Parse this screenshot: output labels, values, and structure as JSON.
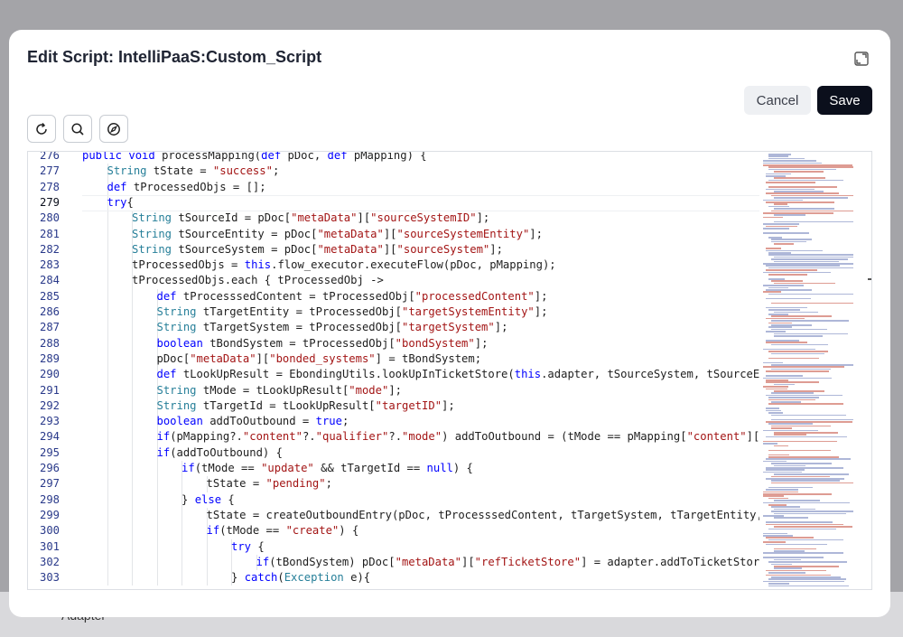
{
  "dialog": {
    "title": "Edit Script: IntelliPaaS:Custom_Script",
    "cancel_label": "Cancel",
    "save_label": "Save"
  },
  "toolbar": {
    "icons": [
      "refresh-icon",
      "search-icon",
      "compass-icon"
    ]
  },
  "background": {
    "row_label": "Adapter"
  },
  "editor": {
    "current_line": 279,
    "first_visible_line": 276,
    "lines": [
      {
        "n": 276,
        "indent": 1,
        "tokens": [
          [
            "kw",
            "public"
          ],
          [
            "t",
            " "
          ],
          [
            "kw",
            "void"
          ],
          [
            "t",
            " processMapping("
          ],
          [
            "kw",
            "def"
          ],
          [
            "t",
            " pDoc, "
          ],
          [
            "kw",
            "def"
          ],
          [
            "t",
            " pMapping) {"
          ]
        ]
      },
      {
        "n": 277,
        "indent": 2,
        "tokens": [
          [
            "ty",
            "String"
          ],
          [
            "t",
            " tState = "
          ],
          [
            "st",
            "\"success\""
          ],
          [
            "t",
            ";"
          ]
        ]
      },
      {
        "n": 278,
        "indent": 2,
        "tokens": [
          [
            "kw",
            "def"
          ],
          [
            "t",
            " tProcessedObjs = [];"
          ]
        ]
      },
      {
        "n": 279,
        "indent": 2,
        "tokens": [
          [
            "kw",
            "try"
          ],
          [
            "t",
            "{"
          ]
        ]
      },
      {
        "n": 280,
        "indent": 3,
        "tokens": [
          [
            "ty",
            "String"
          ],
          [
            "t",
            " tSourceId = pDoc["
          ],
          [
            "st",
            "\"metaData\""
          ],
          [
            "t",
            "]["
          ],
          [
            "st",
            "\"sourceSystemID\""
          ],
          [
            "t",
            "];"
          ]
        ]
      },
      {
        "n": 281,
        "indent": 3,
        "tokens": [
          [
            "ty",
            "String"
          ],
          [
            "t",
            " tSourceEntity = pDoc["
          ],
          [
            "st",
            "\"metaData\""
          ],
          [
            "t",
            "]["
          ],
          [
            "st",
            "\"sourceSystemEntity\""
          ],
          [
            "t",
            "];"
          ]
        ]
      },
      {
        "n": 282,
        "indent": 3,
        "tokens": [
          [
            "ty",
            "String"
          ],
          [
            "t",
            " tSourceSystem = pDoc["
          ],
          [
            "st",
            "\"metaData\""
          ],
          [
            "t",
            "]["
          ],
          [
            "st",
            "\"sourceSystem\""
          ],
          [
            "t",
            "];"
          ]
        ]
      },
      {
        "n": 283,
        "indent": 3,
        "tokens": [
          [
            "t",
            "tProcessedObjs = "
          ],
          [
            "kw",
            "this"
          ],
          [
            "t",
            ".flow_executor.executeFlow(pDoc, pMapping);"
          ]
        ]
      },
      {
        "n": 284,
        "indent": 3,
        "tokens": [
          [
            "t",
            "tProcessedObjs.each { tProcessedObj ->"
          ]
        ]
      },
      {
        "n": 285,
        "indent": 4,
        "tokens": [
          [
            "kw",
            "def"
          ],
          [
            "t",
            " tProcesssedContent = tProcessedObj["
          ],
          [
            "st",
            "\"processedContent\""
          ],
          [
            "t",
            "];"
          ]
        ]
      },
      {
        "n": 286,
        "indent": 4,
        "tokens": [
          [
            "ty",
            "String"
          ],
          [
            "t",
            " tTargetEntity = tProcessedObj["
          ],
          [
            "st",
            "\"targetSystemEntity\""
          ],
          [
            "t",
            "];"
          ]
        ]
      },
      {
        "n": 287,
        "indent": 4,
        "tokens": [
          [
            "ty",
            "String"
          ],
          [
            "t",
            " tTargetSystem = tProcessedObj["
          ],
          [
            "st",
            "\"targetSystem\""
          ],
          [
            "t",
            "];"
          ]
        ]
      },
      {
        "n": 288,
        "indent": 4,
        "tokens": [
          [
            "kw",
            "boolean"
          ],
          [
            "t",
            " tBondSystem = tProcessedObj["
          ],
          [
            "st",
            "\"bondSystem\""
          ],
          [
            "t",
            "];"
          ]
        ]
      },
      {
        "n": 289,
        "indent": 4,
        "tokens": [
          [
            "t",
            "pDoc["
          ],
          [
            "st",
            "\"metaData\""
          ],
          [
            "t",
            "]["
          ],
          [
            "st",
            "\"bonded_systems\""
          ],
          [
            "t",
            "] = tBondSystem;"
          ]
        ]
      },
      {
        "n": 290,
        "indent": 4,
        "tokens": [
          [
            "kw",
            "def"
          ],
          [
            "t",
            " tLookUpResult = EbondingUtils.lookUpInTicketStore("
          ],
          [
            "kw",
            "this"
          ],
          [
            "t",
            ".adapter, tSourceSystem, tSourceEn"
          ]
        ]
      },
      {
        "n": 291,
        "indent": 4,
        "tokens": [
          [
            "ty",
            "String"
          ],
          [
            "t",
            " tMode = tLookUpResult["
          ],
          [
            "st",
            "\"mode\""
          ],
          [
            "t",
            "];"
          ]
        ]
      },
      {
        "n": 292,
        "indent": 4,
        "tokens": [
          [
            "ty",
            "String"
          ],
          [
            "t",
            " tTargetId = tLookUpResult["
          ],
          [
            "st",
            "\"targetID\""
          ],
          [
            "t",
            "];"
          ]
        ]
      },
      {
        "n": 293,
        "indent": 4,
        "tokens": [
          [
            "kw",
            "boolean"
          ],
          [
            "t",
            " addToOutbound = "
          ],
          [
            "kw",
            "true"
          ],
          [
            "t",
            ";"
          ]
        ]
      },
      {
        "n": 294,
        "indent": 4,
        "tokens": [
          [
            "kw",
            "if"
          ],
          [
            "t",
            "(pMapping?."
          ],
          [
            "st",
            "\"content\""
          ],
          [
            "t",
            "?."
          ],
          [
            "st",
            "\"qualifier\""
          ],
          [
            "t",
            "?."
          ],
          [
            "st",
            "\"mode\""
          ],
          [
            "t",
            ") addToOutbound = (tMode == pMapping["
          ],
          [
            "st",
            "\"content\""
          ],
          [
            "t",
            "]['"
          ]
        ]
      },
      {
        "n": 295,
        "indent": 4,
        "tokens": [
          [
            "kw",
            "if"
          ],
          [
            "t",
            "(addToOutbound) {"
          ]
        ]
      },
      {
        "n": 296,
        "indent": 5,
        "tokens": [
          [
            "kw",
            "if"
          ],
          [
            "t",
            "(tMode == "
          ],
          [
            "st",
            "\"update\""
          ],
          [
            "t",
            " && tTargetId == "
          ],
          [
            "kw",
            "null"
          ],
          [
            "t",
            ") {"
          ]
        ]
      },
      {
        "n": 297,
        "indent": 6,
        "tokens": [
          [
            "t",
            "tState = "
          ],
          [
            "st",
            "\"pending\""
          ],
          [
            "t",
            ";"
          ]
        ]
      },
      {
        "n": 298,
        "indent": 5,
        "tokens": [
          [
            "t",
            "} "
          ],
          [
            "kw",
            "else"
          ],
          [
            "t",
            " {"
          ]
        ]
      },
      {
        "n": 299,
        "indent": 6,
        "tokens": [
          [
            "t",
            "tState = createOutboundEntry(pDoc, tProcesssedContent, tTargetSystem, tTargetEntity,"
          ]
        ]
      },
      {
        "n": 300,
        "indent": 6,
        "tokens": [
          [
            "kw",
            "if"
          ],
          [
            "t",
            "(tMode == "
          ],
          [
            "st",
            "\"create\""
          ],
          [
            "t",
            ") {"
          ]
        ]
      },
      {
        "n": 301,
        "indent": 7,
        "tokens": [
          [
            "kw",
            "try"
          ],
          [
            "t",
            " {"
          ]
        ]
      },
      {
        "n": 302,
        "indent": 8,
        "tokens": [
          [
            "kw",
            "if"
          ],
          [
            "t",
            "(tBondSystem) pDoc["
          ],
          [
            "st",
            "\"metaData\""
          ],
          [
            "t",
            "]["
          ],
          [
            "st",
            "\"refTicketStore\""
          ],
          [
            "t",
            "] = adapter.addToTicketStor"
          ]
        ]
      },
      {
        "n": 303,
        "indent": 7,
        "tokens": [
          [
            "t",
            "} "
          ],
          [
            "kw",
            "catch"
          ],
          [
            "t",
            "("
          ],
          [
            "ty",
            "Exception"
          ],
          [
            "t",
            " e){"
          ]
        ]
      }
    ]
  }
}
